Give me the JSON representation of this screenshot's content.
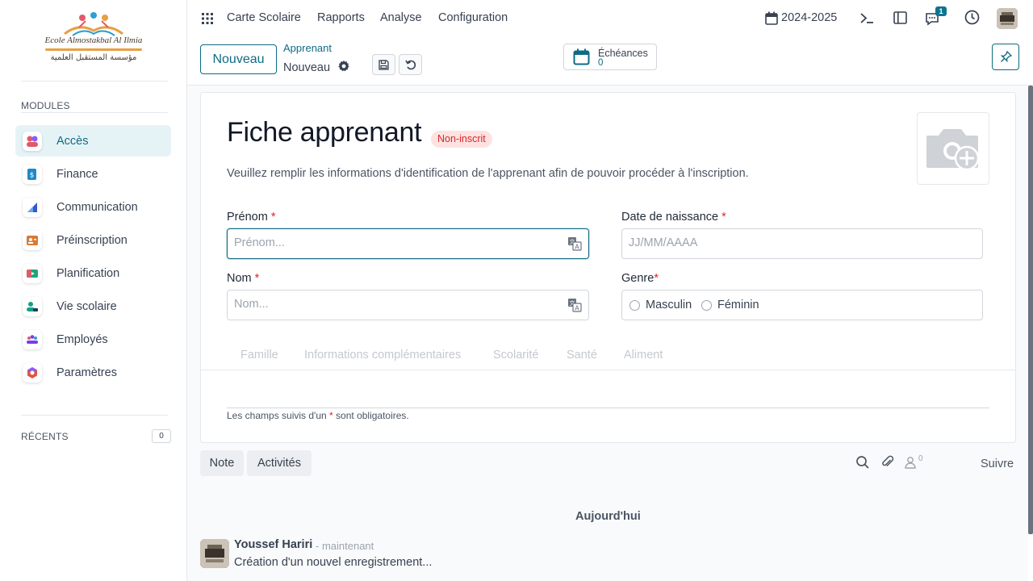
{
  "sidebar": {
    "logo": {
      "title": "Ecole Almostakbal Al Ilmia",
      "arabic": "مؤسسة المستقبل العلمية"
    },
    "modules_heading": "MODULES",
    "modules": [
      {
        "label": "Accès",
        "icon": "acces-icon",
        "color": "#e05a6a"
      },
      {
        "label": "Finance",
        "icon": "finance-icon",
        "color": "#1e88c8"
      },
      {
        "label": "Communication",
        "icon": "communication-icon",
        "color": "#3559c7"
      },
      {
        "label": "Préinscription",
        "icon": "preinscription-icon",
        "color": "#d97a34"
      },
      {
        "label": "Planification",
        "icon": "planification-icon",
        "color": "#1fa37a"
      },
      {
        "label": "Vie scolaire",
        "icon": "vie-scolaire-icon",
        "color": "#14a085"
      },
      {
        "label": "Employés",
        "icon": "employes-icon",
        "color": "#7c3aed"
      },
      {
        "label": "Paramètres",
        "icon": "parametres-icon",
        "color": "#e1553d"
      }
    ],
    "recents_heading": "RÉCENTS",
    "recents_count": "0"
  },
  "topnav": {
    "menu": [
      "Carte Scolaire",
      "Rapports",
      "Analyse",
      "Configuration"
    ],
    "year": "2024-2025",
    "messages_count": "1"
  },
  "control": {
    "new_label": "Nouveau",
    "breadcrumb_parent": "Apprenant",
    "breadcrumb_current": "Nouveau",
    "echeances_label": "Échéances",
    "echeances_count": "0"
  },
  "form": {
    "title": "Fiche apprenant",
    "status": "Non-inscrit",
    "subtitle": "Veuillez remplir les informations d'identification de l'apprenant afin de pouvoir procéder à l'inscription.",
    "prenom_label": "Prénom",
    "prenom_placeholder": "Prénom...",
    "nom_label": "Nom",
    "nom_placeholder": "Nom...",
    "dob_label": "Date de naissance",
    "dob_placeholder": "JJ/MM/AAAA",
    "genre_label": "Genre",
    "genre_options": [
      "Masculin",
      "Féminin"
    ],
    "required_mark": "*",
    "tabs": [
      "Famille",
      "Informations complémentaires",
      "Scolarité",
      "Santé",
      "Aliment"
    ],
    "footnote_before": "Les champs suivis d'un",
    "footnote_after": "sont obligatoires."
  },
  "chatter": {
    "note_label": "Note",
    "activities_label": "Activités",
    "followers_count": "0",
    "follow_label": "Suivre",
    "date_separator": "Aujourd'hui",
    "message": {
      "author": "Youssef Hariri",
      "time": "- maintenant",
      "body": "Création d'un nouvel enregistrement..."
    }
  },
  "colors": {
    "primary": "#0e6b83",
    "danger": "#dc2626",
    "active_bg": "#e6f3f6"
  }
}
